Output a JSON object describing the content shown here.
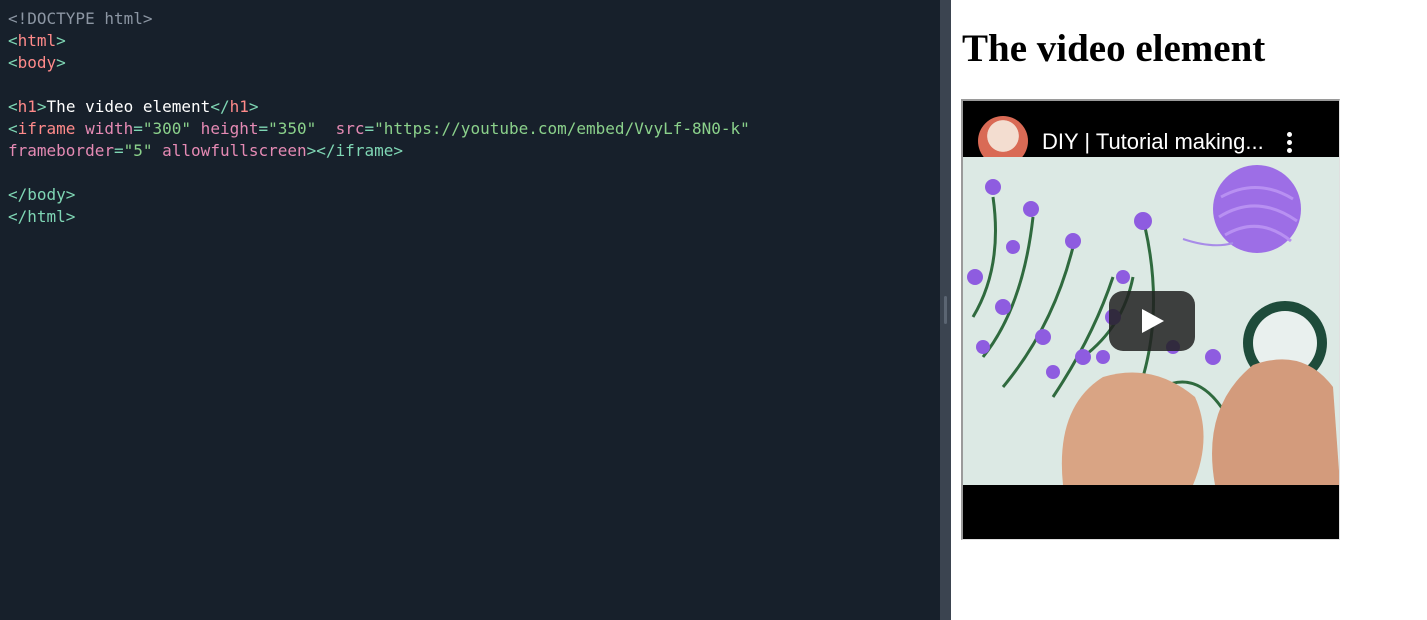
{
  "code_lines": [
    [
      {
        "t": "<!DOCTYPE html>",
        "c": "doctype"
      }
    ],
    [
      {
        "t": "<",
        "c": "punct"
      },
      {
        "t": "html",
        "c": "tag"
      },
      {
        "t": ">",
        "c": "punct"
      }
    ],
    [
      {
        "t": "<",
        "c": "punct"
      },
      {
        "t": "body",
        "c": "tag"
      },
      {
        "t": ">",
        "c": "punct"
      }
    ],
    [],
    [
      {
        "t": "<",
        "c": "punct"
      },
      {
        "t": "h1",
        "c": "tag"
      },
      {
        "t": ">",
        "c": "punct"
      },
      {
        "t": "The video element",
        "c": "text"
      },
      {
        "t": "</",
        "c": "punct"
      },
      {
        "t": "h1",
        "c": "tag"
      },
      {
        "t": ">",
        "c": "punct"
      }
    ],
    [
      {
        "t": "<",
        "c": "punct"
      },
      {
        "t": "iframe",
        "c": "tag"
      },
      {
        "t": " width",
        "c": "attr"
      },
      {
        "t": "=",
        "c": "eq"
      },
      {
        "t": "\"300\"",
        "c": "val"
      },
      {
        "t": " height",
        "c": "attr"
      },
      {
        "t": "=",
        "c": "eq"
      },
      {
        "t": "\"350\"",
        "c": "val"
      },
      {
        "t": "  src",
        "c": "attr"
      },
      {
        "t": "=",
        "c": "eq"
      },
      {
        "t": "\"https://youtube.com/embed/VvyLf-8N0-k\"",
        "c": "val"
      }
    ],
    [
      {
        "t": "frameborder",
        "c": "attr"
      },
      {
        "t": "=",
        "c": "eq"
      },
      {
        "t": "\"5\"",
        "c": "val"
      },
      {
        "t": " allowfullscreen",
        "c": "attr"
      },
      {
        "t": "></",
        "c": "punct"
      },
      {
        "t": "iframe",
        "c": "close"
      },
      {
        "t": ">",
        "c": "punct"
      }
    ],
    [],
    [
      {
        "t": "</",
        "c": "punct"
      },
      {
        "t": "body",
        "c": "close"
      },
      {
        "t": ">",
        "c": "punct"
      }
    ],
    [
      {
        "t": "</",
        "c": "punct"
      },
      {
        "t": "html",
        "c": "close"
      },
      {
        "t": ">",
        "c": "punct"
      }
    ]
  ],
  "preview": {
    "heading": "The video element",
    "video": {
      "title": "DIY | Tutorial making...",
      "avatar_icon": "channel-avatar",
      "menu_icon": "kebab-menu-icon",
      "play_icon": "play-icon"
    }
  },
  "colors": {
    "editor_bg": "#17202b",
    "tag": "#ff8a8a",
    "attr": "#e58ab4",
    "value": "#8bd18b",
    "punct": "#7fd6b4"
  }
}
